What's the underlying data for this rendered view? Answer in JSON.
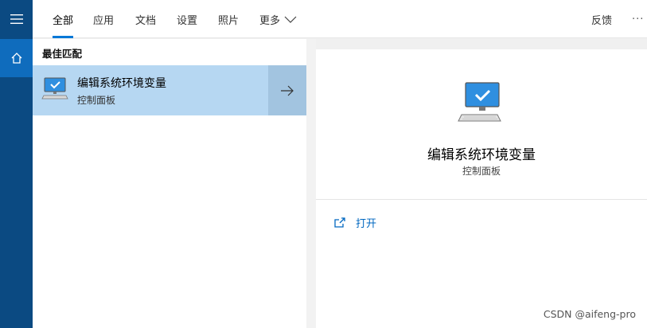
{
  "nav": {
    "tabs": [
      {
        "label": "全部",
        "active": true
      },
      {
        "label": "应用"
      },
      {
        "label": "文档"
      },
      {
        "label": "设置"
      },
      {
        "label": "照片"
      },
      {
        "label": "更多"
      }
    ],
    "feedback_label": "反馈",
    "more_options_label": "···"
  },
  "results": {
    "section_title": "最佳匹配",
    "best_match": {
      "title": "编辑系统环境变量",
      "subtitle": "控制面板",
      "icon": "monitor-check-icon"
    }
  },
  "preview": {
    "title": "编辑系统环境变量",
    "subtitle": "控制面板",
    "actions": [
      {
        "label": "打开",
        "icon": "open-external-icon"
      }
    ]
  },
  "watermark": "CSDN @aifeng-pro",
  "colors": {
    "rail": "#0b4a82",
    "rail_active": "#0f6cbd",
    "accent": "#0078d7",
    "selected_row": "#b6d7f2",
    "link": "#0067c0"
  }
}
